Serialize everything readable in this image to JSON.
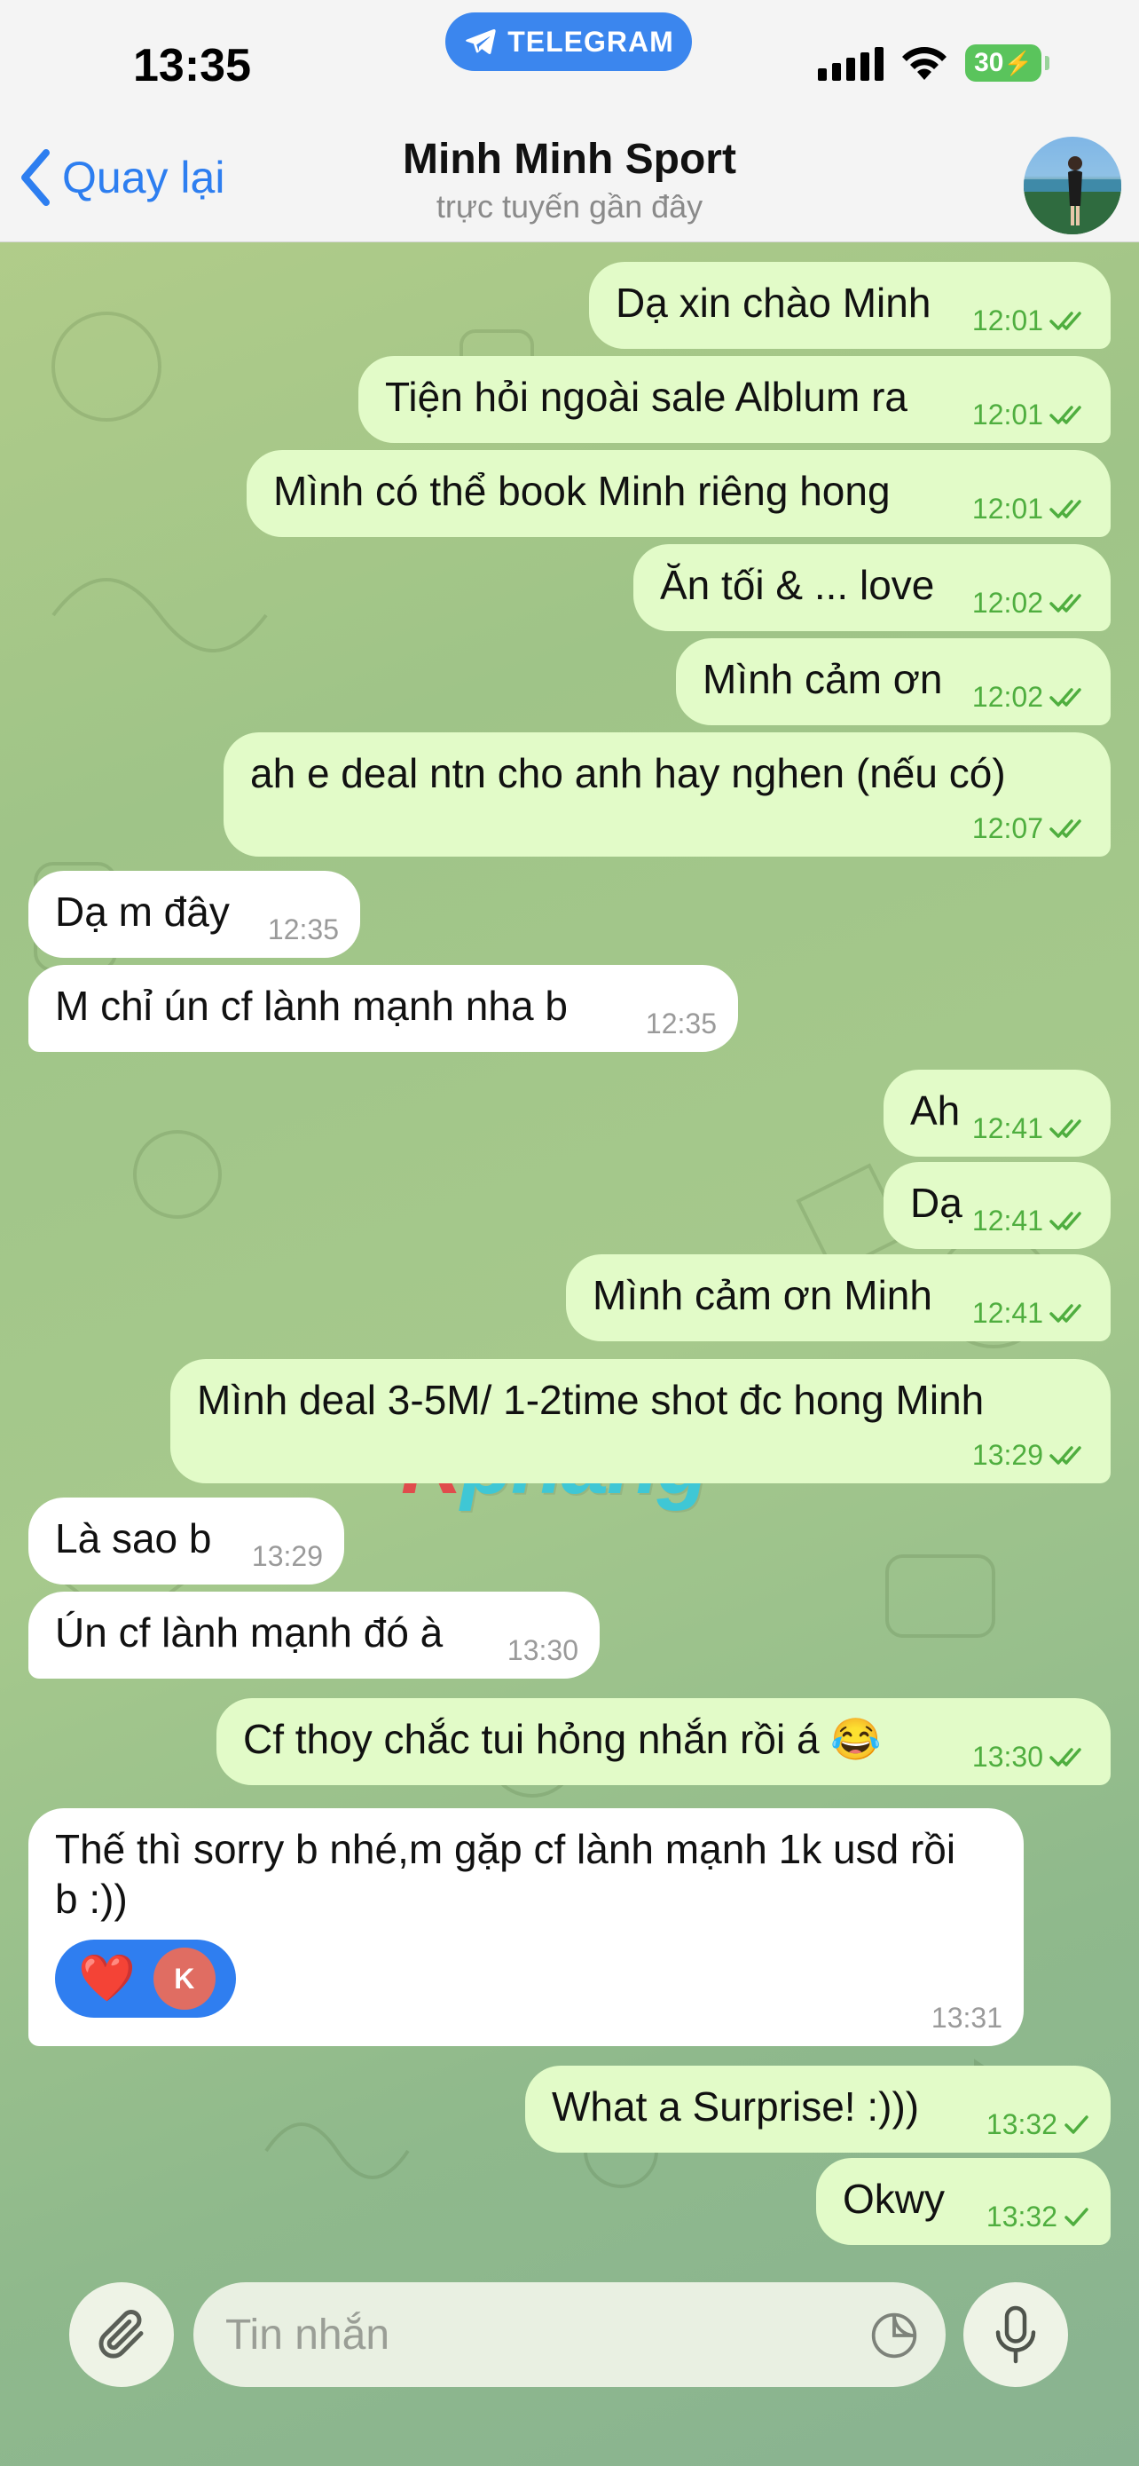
{
  "status_bar": {
    "time": "13:35",
    "telegram_label": "TELEGRAM",
    "battery": "30"
  },
  "header": {
    "back_label": "Quay lại",
    "title": "Minh Minh Sport",
    "subtitle": "trực tuyến gần đây"
  },
  "watermark": {
    "first": "R",
    "rest": "phang"
  },
  "messages": [
    {
      "dir": "out",
      "text": "Dạ xin chào Minh",
      "time": "12:01",
      "status": "read"
    },
    {
      "dir": "out",
      "text": "Tiện hỏi ngoài sale Alblum ra",
      "time": "12:01",
      "status": "read"
    },
    {
      "dir": "out",
      "text": "Mình có thể book Minh riêng hong",
      "time": "12:01",
      "status": "read"
    },
    {
      "dir": "out",
      "text": "Ăn tối & ... love",
      "time": "12:02",
      "status": "read"
    },
    {
      "dir": "out",
      "text": "Mình cảm ơn",
      "time": "12:02",
      "status": "read"
    },
    {
      "dir": "out",
      "text": "ah e deal ntn cho anh hay nghen (nếu có)",
      "time": "12:07",
      "status": "read"
    },
    {
      "dir": "in",
      "text": "Dạ m đây",
      "time": "12:35"
    },
    {
      "dir": "in",
      "text": "M chỉ ún cf lành mạnh nha b",
      "time": "12:35"
    },
    {
      "dir": "out",
      "text": "Ah",
      "time": "12:41",
      "status": "read"
    },
    {
      "dir": "out",
      "text": "Dạ",
      "time": "12:41",
      "status": "read"
    },
    {
      "dir": "out",
      "text": "Mình cảm ơn Minh",
      "time": "12:41",
      "status": "read"
    },
    {
      "dir": "out",
      "text": "Mình deal 3-5M/ 1-2time shot đc hong Minh",
      "time": "13:29",
      "status": "read"
    },
    {
      "dir": "in",
      "text": "Là sao b",
      "time": "13:29"
    },
    {
      "dir": "in",
      "text": "Ún cf lành mạnh đó à",
      "time": "13:30"
    },
    {
      "dir": "out",
      "text": "Cf thoy chắc tui hỏng nhắn rồi á 😂",
      "time": "13:30",
      "status": "read"
    },
    {
      "dir": "in",
      "text": "Thế thì sorry b nhé,m gặp cf lành mạnh 1k usd rồi b :))",
      "time": "13:31",
      "reactions": {
        "emoji": "❤️",
        "avatar_letter": "K"
      }
    },
    {
      "dir": "out",
      "text": "What a Surprise! :)))",
      "time": "13:32",
      "status": "sent"
    },
    {
      "dir": "out",
      "text": "Okwy",
      "time": "13:32",
      "status": "sent"
    }
  ],
  "composer": {
    "placeholder": "Tin nhắn"
  },
  "colors": {
    "accent": "#2d7ef0",
    "outgoing_bubble": "#e2fbc8",
    "incoming_bubble": "#ffffff",
    "check": "#4fae3f"
  },
  "icons": [
    "telegram-icon",
    "signal-icon",
    "wifi-icon",
    "battery-icon",
    "back-chevron-icon",
    "double-check-icon",
    "check-icon",
    "heart-icon",
    "paperclip-icon",
    "sticker-icon",
    "microphone-icon"
  ]
}
